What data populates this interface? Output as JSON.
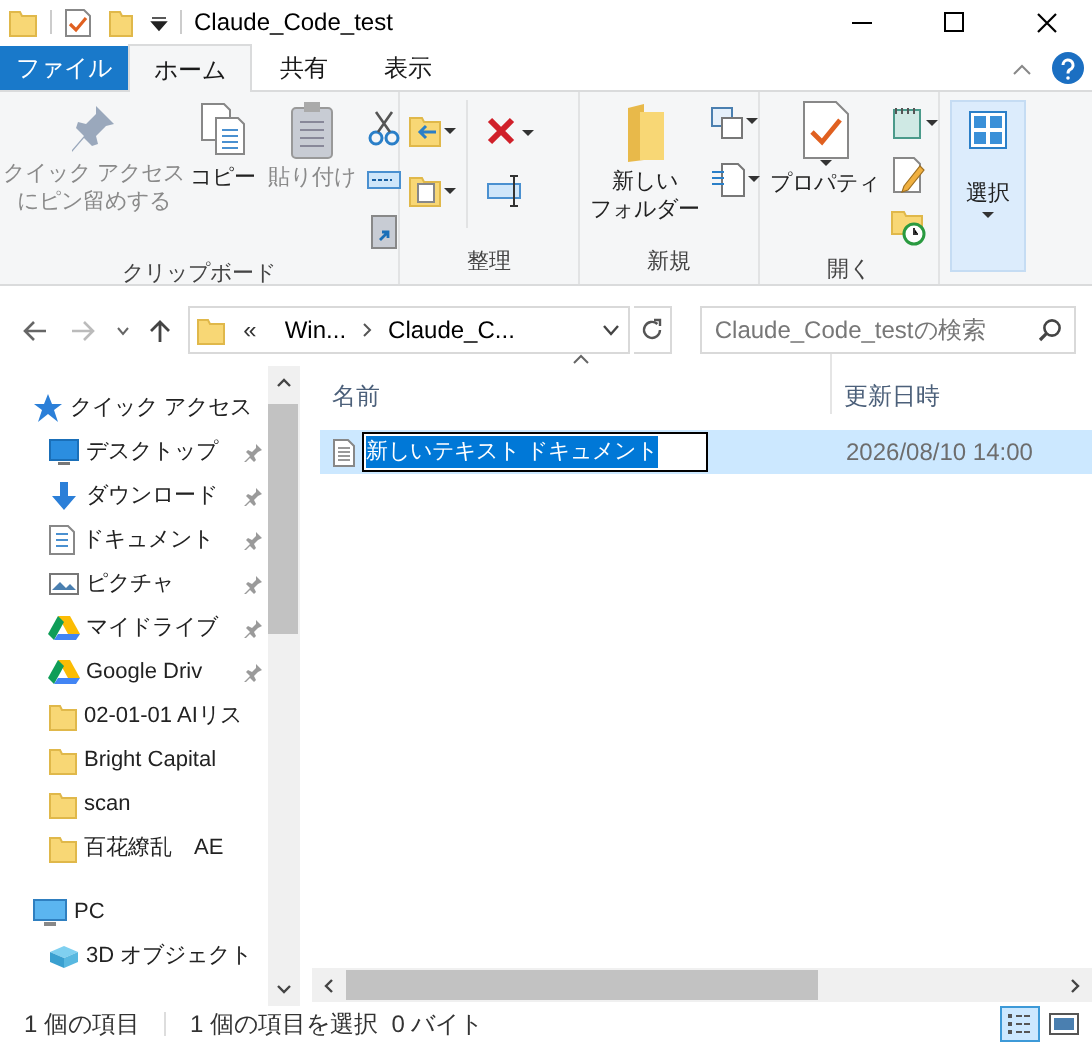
{
  "window": {
    "title": "Claude_Code_test"
  },
  "ribbon_tabs": [
    {
      "label": "ファイル",
      "kind": "file",
      "selected": false
    },
    {
      "label": "ホーム",
      "kind": "tab",
      "selected": true
    },
    {
      "label": "共有",
      "kind": "tab",
      "selected": false
    },
    {
      "label": "表示",
      "kind": "tab",
      "selected": false
    }
  ],
  "ribbon_groups": [
    {
      "label": "クリップボード",
      "buttons": [
        {
          "lines": [
            "クイック アクセス",
            "にピン留めする"
          ],
          "disabled": true
        },
        {
          "lines": [
            "コピー"
          ],
          "disabled": false
        },
        {
          "lines": [
            "貼り付け"
          ],
          "disabled": true
        }
      ]
    },
    {
      "label": "整理"
    },
    {
      "label": "新規",
      "buttons": [
        {
          "lines": [
            "新しい",
            "フォルダー"
          ],
          "disabled": false
        }
      ]
    },
    {
      "label": "開く",
      "buttons": [
        {
          "lines": [
            "プロパティ"
          ],
          "disabled": false
        }
      ]
    },
    {
      "buttons": [
        {
          "lines": [
            "選択"
          ],
          "disabled": false
        }
      ]
    }
  ],
  "address": {
    "overflow": "«",
    "segments": [
      "Win...",
      "Claude_C..."
    ],
    "search_placeholder": "Claude_Code_testの検索"
  },
  "columns": [
    {
      "label": "名前",
      "sorted": true
    },
    {
      "label": "更新日時",
      "sorted": false
    }
  ],
  "files": [
    {
      "name": "新しいテキスト ドキュメント",
      "modified": "2026/08/10 14:00",
      "selected": true,
      "renaming": true
    }
  ],
  "navigation": [
    {
      "label": "クイック アクセス",
      "kind": "star",
      "pinned": false
    },
    {
      "label": "デスクトップ",
      "kind": "desktop",
      "pinned": true
    },
    {
      "label": "ダウンロード",
      "kind": "download",
      "pinned": true
    },
    {
      "label": "ドキュメント",
      "kind": "document",
      "pinned": true
    },
    {
      "label": "ピクチャ",
      "kind": "picture",
      "pinned": true
    },
    {
      "label": "マイドライブ",
      "kind": "drive",
      "pinned": true
    },
    {
      "label": "Google Driv",
      "kind": "drive",
      "pinned": true
    },
    {
      "label": "02-01-01 AIリス",
      "kind": "folder",
      "pinned": false
    },
    {
      "label": "Bright Capital",
      "kind": "folder",
      "pinned": false
    },
    {
      "label": "scan",
      "kind": "folder",
      "pinned": false
    },
    {
      "label": "百花繚乱　AE",
      "kind": "folder",
      "pinned": false
    },
    {
      "label": "PC",
      "kind": "pc",
      "pinned": false
    },
    {
      "label": "3D オブジェクト",
      "kind": "cube",
      "pinned": false
    }
  ],
  "status_bar": {
    "item_count": "1 個の項目",
    "selection": "1 個の項目を選択  0 バイト"
  },
  "views": [
    {
      "kind": "details",
      "selected": true
    },
    {
      "kind": "large_icons",
      "selected": false
    }
  ]
}
